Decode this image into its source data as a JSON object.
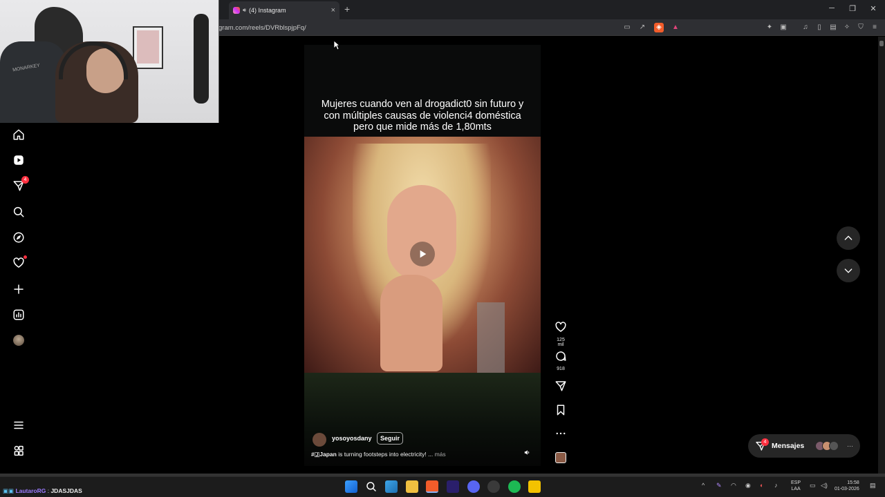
{
  "browser": {
    "tab_title": "(4) Instagram",
    "url": "gram.com/reels/DVRblspjpFq/",
    "new_tab": "+",
    "close": "×",
    "minimize": "─",
    "restore": "❐",
    "window_close": "✕"
  },
  "sidebar": {
    "messages_badge": "4"
  },
  "reel": {
    "caption": "Mujeres cuando ven al drogadict0 sin futuro y con múltiples causas de violenci4 doméstica pero que mide más de 1,80mts",
    "author": "yosoyosdany",
    "follow_label": "Seguir",
    "hashtag": "#🇯Japan",
    "description": " is turning footsteps into electricity! ... ",
    "more": "más",
    "likes": "125 mil",
    "comments": "918"
  },
  "messages": {
    "label": "Mensajes",
    "badge": "4",
    "more": "···"
  },
  "stream": {
    "username": "LautaroRG",
    "separator": " : ",
    "message": "JDASJDAS"
  },
  "system": {
    "lang_top": "ESP",
    "lang_bottom": "LAA",
    "time": "15:58",
    "date": "01-03-2026"
  },
  "colors": {
    "notification": "#ff3040",
    "background": "#000000",
    "panel": "#262626"
  }
}
